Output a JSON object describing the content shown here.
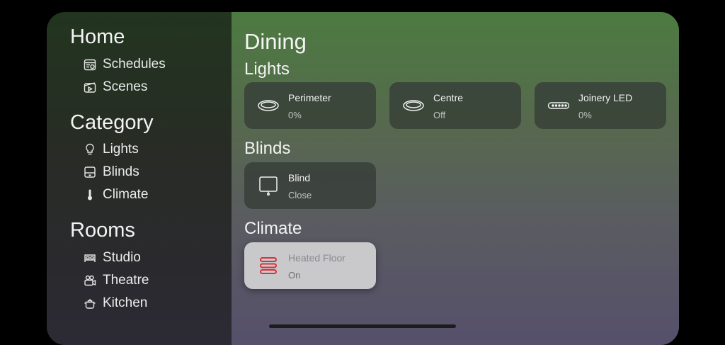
{
  "sidebar": {
    "home": {
      "heading": "Home",
      "items": [
        {
          "label": "Schedules",
          "icon": "calendar-icon"
        },
        {
          "label": "Scenes",
          "icon": "scene-icon"
        }
      ]
    },
    "category": {
      "heading": "Category",
      "items": [
        {
          "label": "Lights",
          "icon": "lightbulb-icon"
        },
        {
          "label": "Blinds",
          "icon": "blind-icon"
        },
        {
          "label": "Climate",
          "icon": "thermometer-icon"
        }
      ]
    },
    "rooms": {
      "heading": "Rooms",
      "items": [
        {
          "label": "Studio",
          "icon": "bed-icon"
        },
        {
          "label": "Theatre",
          "icon": "projector-icon"
        },
        {
          "label": "Kitchen",
          "icon": "pot-icon"
        }
      ]
    }
  },
  "main": {
    "room_title": "Dining",
    "sections": {
      "lights": {
        "title": "Lights",
        "tiles": [
          {
            "name": "Perimeter",
            "state": "0%",
            "icon": "downlight-icon"
          },
          {
            "name": "Centre",
            "state": "Off",
            "icon": "downlight-icon"
          },
          {
            "name": "Joinery LED",
            "state": "0%",
            "icon": "led-strip-icon"
          }
        ]
      },
      "blinds": {
        "title": "Blinds",
        "tiles": [
          {
            "name": "Blind",
            "state": "Close",
            "icon": "blind-icon"
          }
        ]
      },
      "climate": {
        "title": "Climate",
        "tiles": [
          {
            "name": "Heated Floor",
            "state": "On",
            "icon": "heated-floor-icon"
          }
        ]
      }
    }
  },
  "colors": {
    "heated_floor_accent": "#d8323a",
    "active_tile": "#c9c9cc"
  }
}
